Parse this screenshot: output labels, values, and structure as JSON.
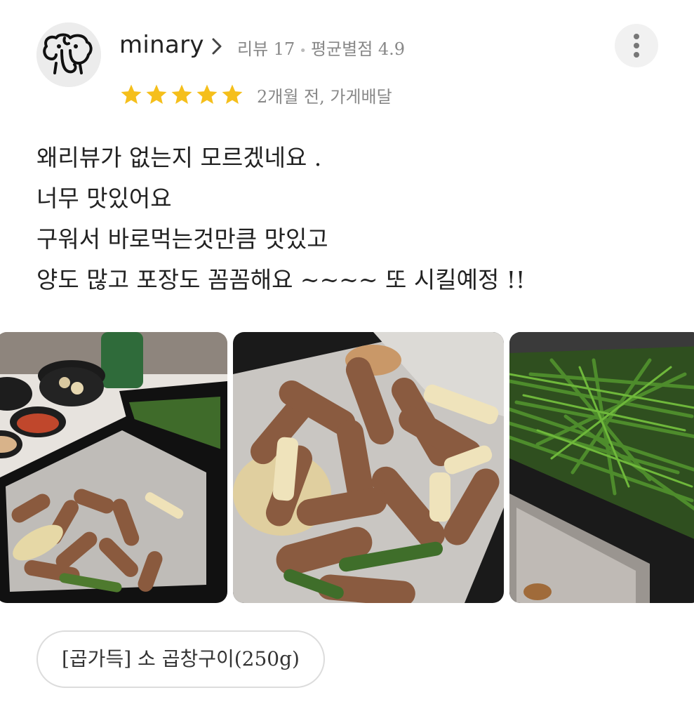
{
  "reviewer": {
    "name": "minary",
    "review_count_label": "리뷰 17",
    "avg_rating_label": "평균별점 4.9",
    "avatar_icon": "elephant-icon"
  },
  "rating": {
    "stars": 5,
    "max": 5,
    "color": "#f5bf1b"
  },
  "date_label": "2개월 전, 가게배달",
  "review_lines": [
    "왜리뷰가 없는지 모르겠네요 .",
    "너무 맛있어요",
    "구워서 바로먹는것만큼 맛있고",
    "양도 많고 포장도 꼼꼼해요 ~~~~ 또 시킬예정 !!"
  ],
  "photos_count": 3,
  "menu_item": "[곱가득] 소 곱창구이(250g)",
  "icons": [
    "elephant-icon",
    "chevron-right-icon",
    "star-icon",
    "more-vertical-icon"
  ]
}
